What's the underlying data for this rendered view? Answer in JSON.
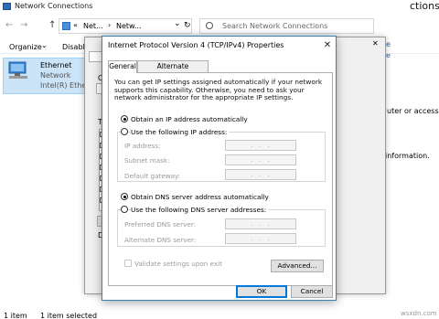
{
  "bg_window": {
    "title": "Network Connections",
    "nav_back": "←",
    "nav_forward": "→",
    "nav_up": "↑",
    "address_chevron": "«",
    "address_parts": [
      "Net...",
      "Netw..."
    ],
    "address_dropdown": "⌄",
    "refresh": "↻",
    "search_placeholder": "Search Network Connections",
    "right_overflow_title": "ctions",
    "toolbar": {
      "organize": "Organize",
      "disable": "Disable",
      "view_icon": "▤",
      "help_icon": "?"
    },
    "right_overflow_link": "e",
    "adapter": {
      "name": "Ethernet",
      "network": "Network",
      "device": "Intel(R) Etherr"
    },
    "right_overflow_texts": [
      "uter or access",
      "information."
    ],
    "status": {
      "item_count": "1 item",
      "selected": "1 item selected"
    }
  },
  "mid_window": {
    "fragments": [
      "Co",
      "Th",
      "D"
    ],
    "close_label": "✕"
  },
  "dialog": {
    "title": "Internet Protocol Version 4 (TCP/IPv4) Properties",
    "close_label": "✕",
    "tabs": [
      "General",
      "Alternate Configuration"
    ],
    "description": "You can get IP settings assigned automatically if your network supports this capability. Otherwise, you need to ask your network administrator for the appropriate IP settings.",
    "ip_options": {
      "auto": "Obtain an IP address automatically",
      "manual": "Use the following IP address:",
      "selected": "auto"
    },
    "ip_fields": {
      "ip_label": "IP address:",
      "mask_label": "Subnet mask:",
      "gateway_label": "Default gateway:",
      "ip_value": "...",
      "mask_value": "...",
      "gateway_value": "..."
    },
    "dns_options": {
      "auto": "Obtain DNS server address automatically",
      "manual": "Use the following DNS server addresses:",
      "selected": "auto"
    },
    "dns_fields": {
      "preferred_label": "Preferred DNS server:",
      "alternate_label": "Alternate DNS server:",
      "preferred_value": "...",
      "alternate_value": "..."
    },
    "validate_label": "Validate settings upon exit",
    "buttons": {
      "advanced": "Advanced...",
      "ok": "OK",
      "cancel": "Cancel"
    }
  },
  "watermark": "wsxdn.com",
  "colors": {
    "accent": "#0078d7",
    "selection": "#cce4f7",
    "dialog_border": "#3c7fb1"
  }
}
